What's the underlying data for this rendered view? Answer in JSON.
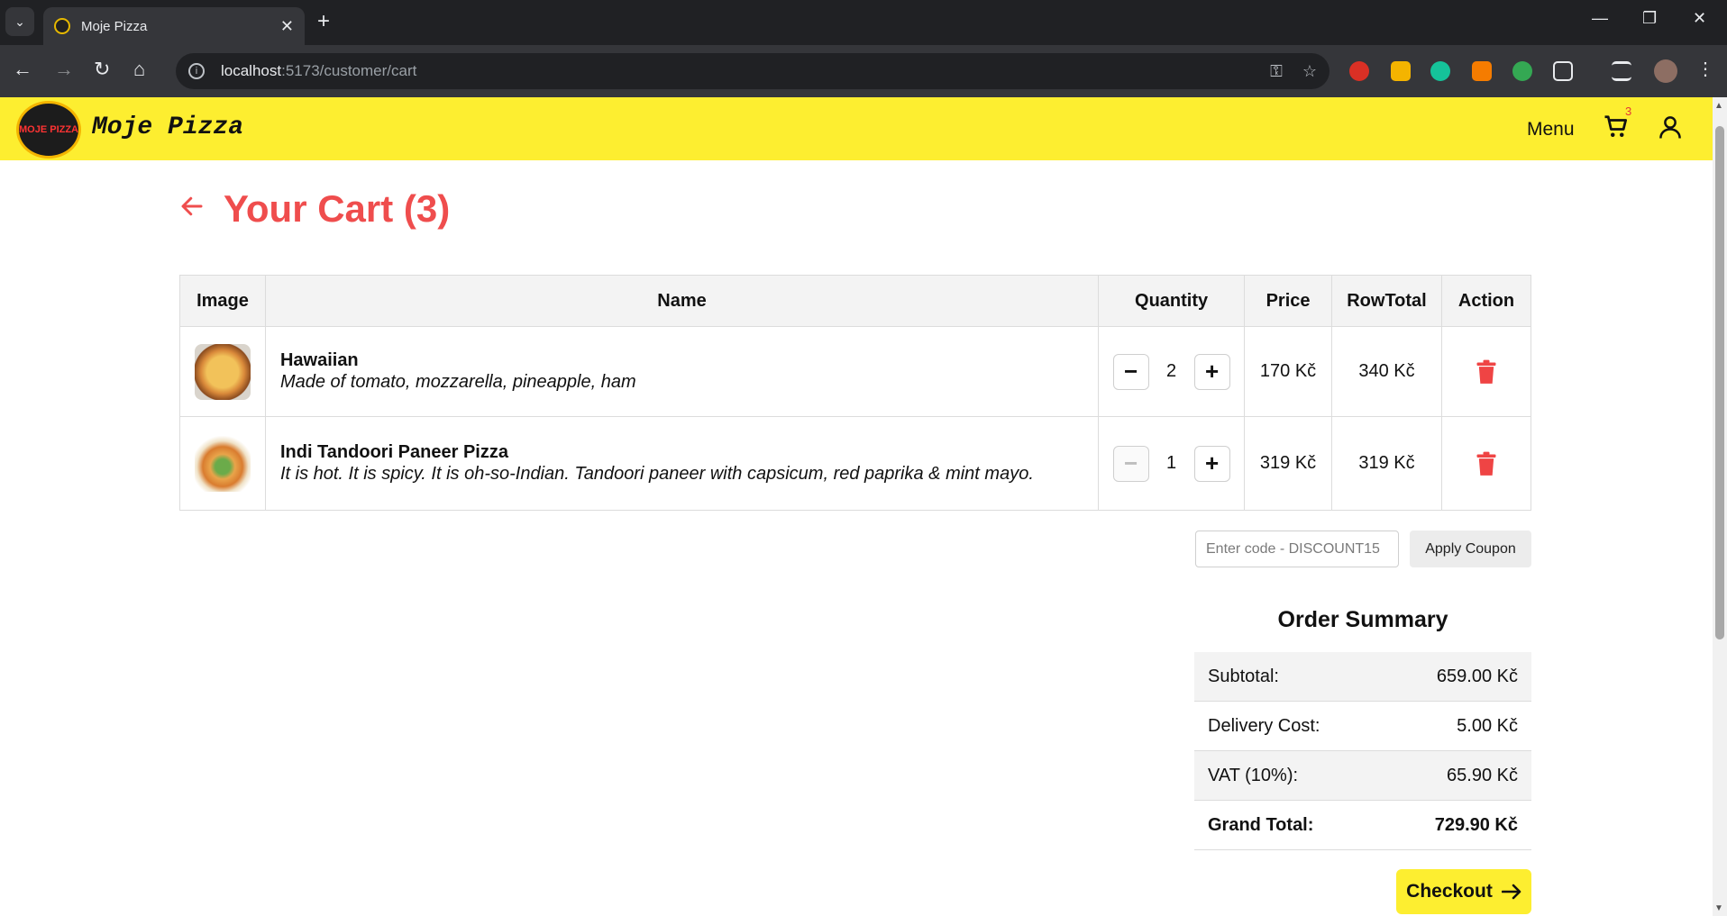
{
  "browser": {
    "tab_title": "Moje Pizza",
    "url_host": "localhost",
    "url_path": ":5173/customer/cart"
  },
  "header": {
    "logo_text": "MOJE PIZZA",
    "brand": "Moje Pizza",
    "menu_label": "Menu",
    "cart_count": "3"
  },
  "page": {
    "title": "Your Cart (3)"
  },
  "table": {
    "headers": [
      "Image",
      "Name",
      "Quantity",
      "Price",
      "RowTotal",
      "Action"
    ],
    "rows": [
      {
        "name": "Hawaiian",
        "description": "Made of tomato, mozzarella, pineapple, ham",
        "quantity": "2",
        "price": "170 Kč",
        "row_total": "340 Kč"
      },
      {
        "name": "Indi Tandoori Paneer Pizza",
        "description": "It is hot. It is spicy. It is oh-so-Indian. Tandoori paneer with capsicum, red paprika & mint mayo.",
        "quantity": "1",
        "price": "319 Kč",
        "row_total": "319 Kč"
      }
    ]
  },
  "coupon": {
    "placeholder": "Enter code - DISCOUNT15",
    "button": "Apply Coupon"
  },
  "summary": {
    "title": "Order Summary",
    "rows": [
      {
        "label": "Subtotal:",
        "value": "659.00 Kč"
      },
      {
        "label": "Delivery Cost:",
        "value": "5.00 Kč"
      },
      {
        "label": "VAT (10%):",
        "value": "65.90 Kč"
      },
      {
        "label": "Grand Total:",
        "value": "729.90 Kč"
      }
    ]
  },
  "checkout": {
    "label": "Checkout"
  },
  "colors": {
    "accent_red": "#ef4d4d",
    "brand_yellow": "#fdee30"
  }
}
